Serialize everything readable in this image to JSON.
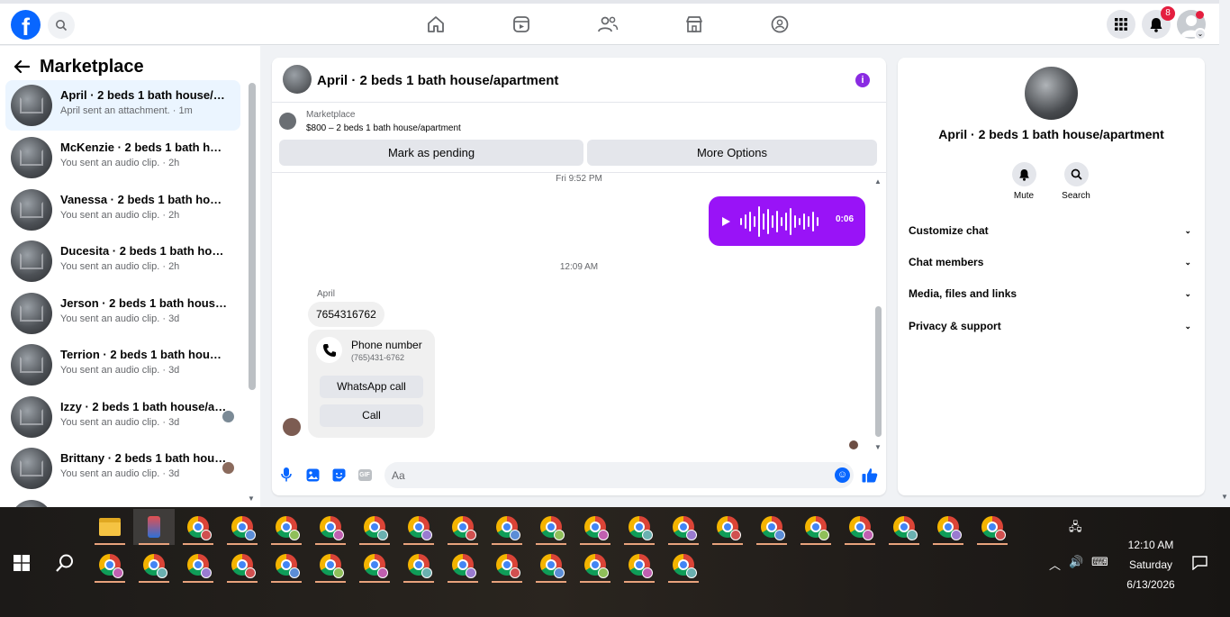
{
  "topbar": {
    "logo": "f",
    "icons": [
      "search-icon",
      "home-icon",
      "reels-icon",
      "friends-icon",
      "marketplace-icon",
      "groups-icon",
      "menu-grid-icon",
      "notifications-icon"
    ],
    "notification_count": "8"
  },
  "left_panel": {
    "title": "Marketplace",
    "conversations": [
      {
        "title": "April · 2 beds 1 bath house/apartment",
        "subtitle": "April sent an attachment. · 1m",
        "active": true
      },
      {
        "title": "McKenzie · 2 beds 1 bath house/apartment",
        "subtitle": "You sent an audio clip. · 2h"
      },
      {
        "title": "Vanessa · 2 beds 1 bath house/apartment",
        "subtitle": "You sent an audio clip. · 2h"
      },
      {
        "title": "Ducesita · 2 beds 1 bath house/apartment",
        "subtitle": "You sent an audio clip. · 2h"
      },
      {
        "title": "Jerson · 2 beds 1 bath house/apartment",
        "subtitle": "You sent an audio clip. · 3d"
      },
      {
        "title": "Terrion · 2 beds 1 bath house/apartment",
        "subtitle": "You sent an audio clip. · 3d"
      },
      {
        "title": "Izzy · 2 beds 1 bath house/apartment",
        "subtitle": "You sent an audio clip. · 3d"
      },
      {
        "title": "Brittany · 2 beds 1 bath house/apartment",
        "subtitle": "You sent an audio clip. · 3d"
      }
    ]
  },
  "chat": {
    "title": "April · 2 beds 1 bath house/apartment",
    "marketplace_label": "Marketplace",
    "listing": "$800 – 2 beds 1 bath house/apartment",
    "mark_pending": "Mark as pending",
    "more_options": "More Options",
    "timestamp_1": "Fri 9:52 PM",
    "audio_duration": "0:06",
    "timestamp_2": "12:09 AM",
    "sender_name": "April",
    "message_number": "7654316762",
    "phone_card_title": "Phone number",
    "phone_card_number": "(765)431-6762",
    "whatsapp_call": "WhatsApp call",
    "call": "Call",
    "composer_placeholder": "Aa",
    "composer_icons": [
      "microphone-icon",
      "photo-icon",
      "sticker-icon",
      "gif-icon",
      "emoji-icon",
      "like-icon"
    ],
    "gif_label": "GIF"
  },
  "info_panel": {
    "name": "April · 2 beds 1 bath house/apartment",
    "mute": "Mute",
    "search": "Search",
    "sections": [
      "Customize chat",
      "Chat members",
      "Media, files and links",
      "Privacy & support"
    ]
  },
  "taskbar": {
    "time": "12:10 AM",
    "day": "Saturday",
    "date": "6/13/2026",
    "badge_colors": [
      "#d05050",
      "#5b8dd6",
      "#8fbf5a",
      "#c05fb0",
      "#6ab0b0",
      "#9a7bd0"
    ]
  },
  "colors": {
    "brand": "#0866ff",
    "audio_bubble": "#9913f7",
    "info_icon": "#8a2be2",
    "badge": "#e41e3f"
  }
}
